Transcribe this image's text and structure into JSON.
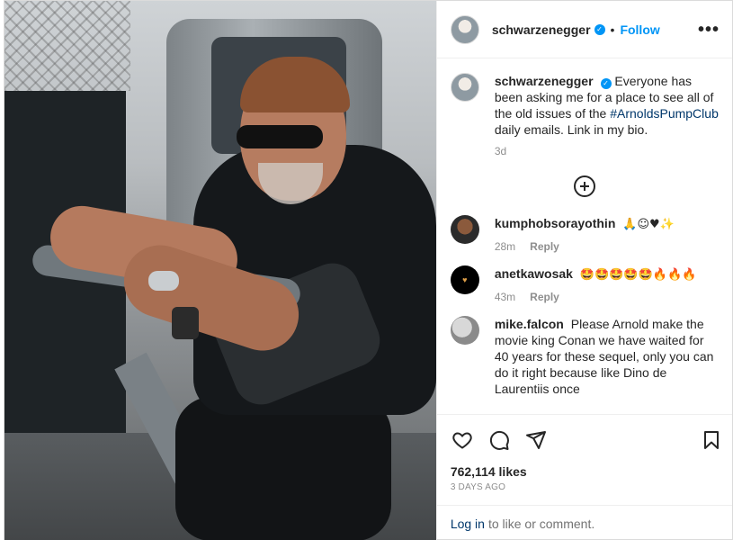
{
  "post": {
    "author": "schwarzenegger",
    "follow_label": "Follow",
    "separator": "•",
    "more_label": "•••",
    "caption_user": "schwarzenegger",
    "caption_text_before": "Everyone has been asking me for a place to see all of the old issues of the",
    "caption_hashtag": "#ArnoldsPumpClub",
    "caption_text_after": "daily emails. Link in my bio.",
    "caption_time": "3d",
    "likes": "762,114 likes",
    "date": "3 DAYS AGO"
  },
  "comments": [
    {
      "user": "kumphobsorayothin",
      "text": "🙏☺♥✨",
      "time": "28m",
      "reply": "Reply"
    },
    {
      "user": "anetkawosak",
      "text": "🤩🤩🤩🤩🤩🔥🔥🔥",
      "time": "43m",
      "reply": "Reply"
    },
    {
      "user": "mike.falcon",
      "text": "Please Arnold make the movie king Conan we have waited for 40 years for these sequel, only you can do it right because like Dino de Laurentiis once"
    }
  ],
  "footer": {
    "login_link": "Log in",
    "login_rest": "to like or comment."
  },
  "icons": {
    "verified": "verified-badge-icon",
    "like": "heart-icon",
    "comment": "comment-icon",
    "share": "paper-plane-icon",
    "save": "bookmark-icon",
    "load_more": "plus-circle-icon"
  },
  "colors": {
    "accent": "#0095f6",
    "hashtag": "#00376b",
    "muted": "#8e8e8e"
  }
}
